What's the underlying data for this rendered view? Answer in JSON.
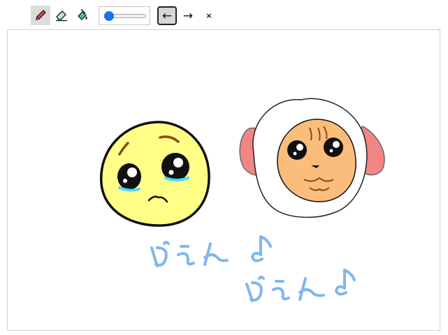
{
  "toolbar": {
    "tools": [
      {
        "icon": "pencil-icon",
        "active": true
      },
      {
        "icon": "eraser-icon",
        "active": false
      },
      {
        "icon": "fill-bucket-icon",
        "active": false
      }
    ],
    "brush_size": {
      "min": 1,
      "max": 50,
      "value": 1
    },
    "undo_label": "←",
    "redo_label": "→",
    "clear_label": "×"
  },
  "canvas": {
    "background": "#ffffff",
    "drawing": {
      "text_color": "#7fb6f0",
      "emoji_yellow": "#ffff88",
      "sheep_face": "#fbbd7b",
      "sheep_horn": "#f38585",
      "tear_color": "#4cd8ff"
    }
  }
}
